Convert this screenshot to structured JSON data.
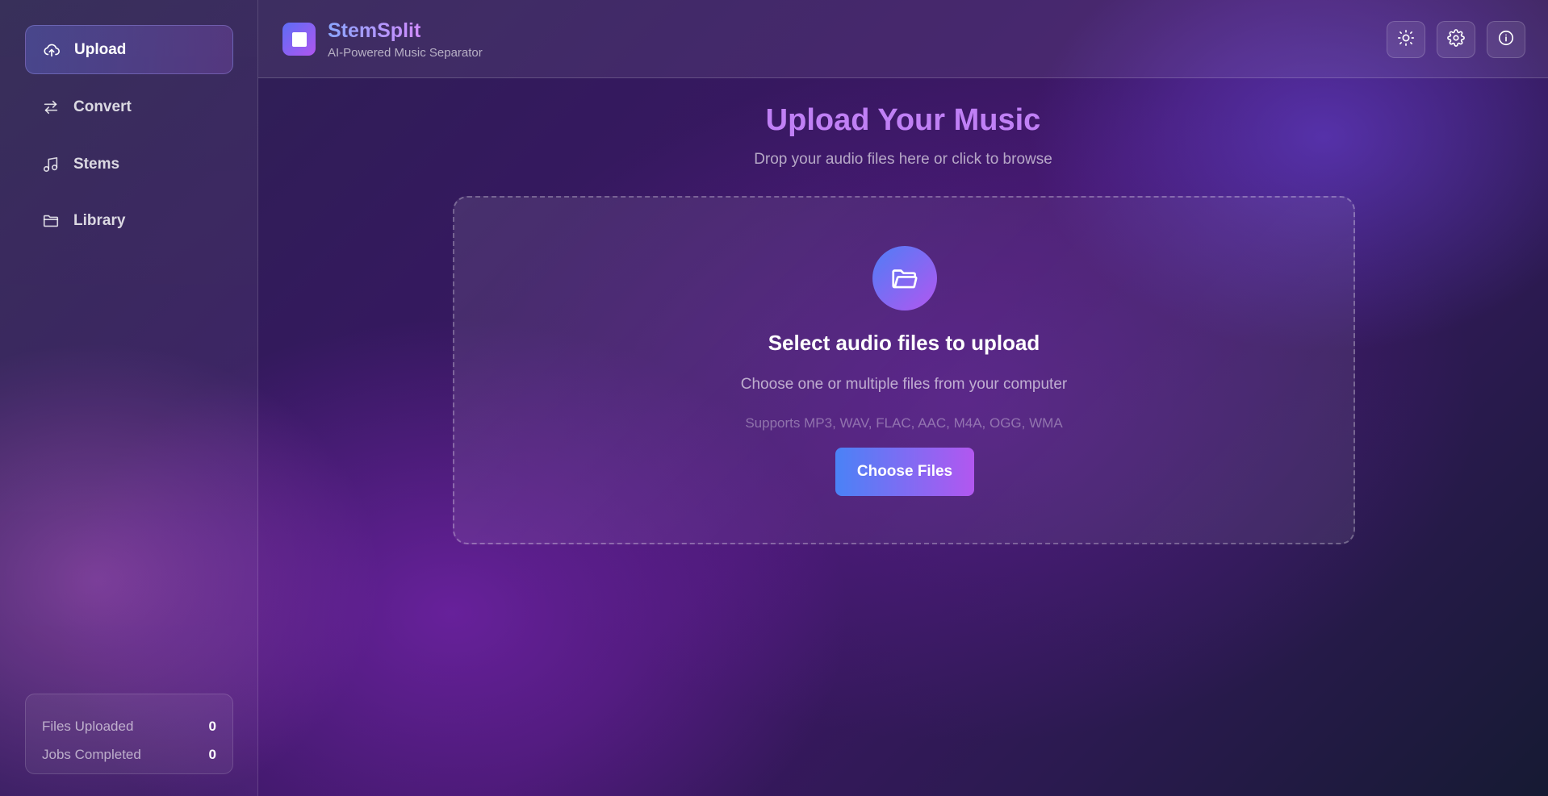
{
  "sidebar": {
    "items": [
      {
        "label": "Upload",
        "icon": "cloud-upload-icon",
        "active": true
      },
      {
        "label": "Convert",
        "icon": "convert-arrows-icon",
        "active": false
      },
      {
        "label": "Stems",
        "icon": "music-note-icon",
        "active": false
      },
      {
        "label": "Library",
        "icon": "folder-icon",
        "active": false
      }
    ],
    "stats": [
      {
        "label": "Files Uploaded",
        "value": "0"
      },
      {
        "label": "Jobs Completed",
        "value": "0"
      }
    ]
  },
  "header": {
    "app_name": "StemSplit",
    "tagline": "AI-Powered Music Separator",
    "buttons": [
      "sun-icon",
      "gear-icon",
      "info-icon"
    ]
  },
  "main": {
    "title": "Upload Your Music",
    "subtitle": "Drop your audio files here or click to browse",
    "dropzone": {
      "icon": "folder-open-icon",
      "title": "Select audio files to upload",
      "subtitle": "Choose one or multiple files from your computer",
      "formats": "Supports MP3, WAV, FLAC, AAC, M4A, OGG, WMA",
      "button_label": "Choose Files"
    }
  },
  "colors": {
    "accent_start": "#4a82f6",
    "accent_end": "#b257f0",
    "title": "#c080f5"
  }
}
